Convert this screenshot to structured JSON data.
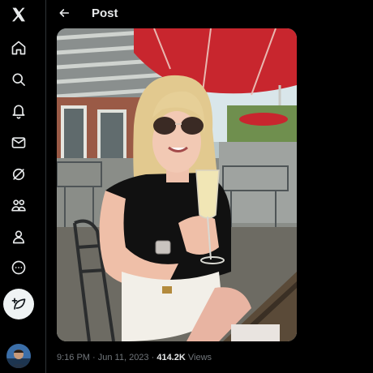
{
  "sidebar": {
    "items": [
      {
        "icon": "x-logo-icon"
      },
      {
        "icon": "home-icon"
      },
      {
        "icon": "search-icon"
      },
      {
        "icon": "bell-icon"
      },
      {
        "icon": "mail-icon"
      },
      {
        "icon": "grok-icon"
      },
      {
        "icon": "communities-icon"
      },
      {
        "icon": "profile-icon"
      },
      {
        "icon": "more-icon"
      }
    ],
    "compose_icon": "compose-feather-icon"
  },
  "header": {
    "title": "Post"
  },
  "post": {
    "time": "9:16 PM",
    "separator": " · ",
    "date": "Jun 11, 2023",
    "separator2": " · ",
    "views_count": "414.2K",
    "views_label": " Views"
  },
  "colors": {
    "background": "#000000",
    "text": "#e7e9ea",
    "muted": "#71767b",
    "awning_red": "#c8262e"
  }
}
